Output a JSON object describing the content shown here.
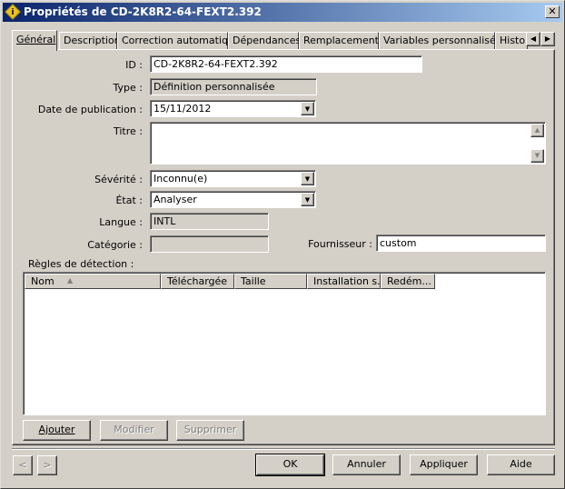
{
  "window": {
    "title": "Propriétés de CD-2K8R2-64-FEXT2.392",
    "close_glyph": "✕"
  },
  "tabs": [
    {
      "label": "Général"
    },
    {
      "label": "Description"
    },
    {
      "label": "Correction automatique"
    },
    {
      "label": "Dépendances"
    },
    {
      "label": "Remplacements"
    },
    {
      "label": "Variables personnalisées"
    },
    {
      "label": "Histori"
    }
  ],
  "tab_scroll": {
    "left": "◀",
    "right": "▶"
  },
  "form": {
    "id_label": "ID :",
    "id_value": "CD-2K8R2-64-FEXT2.392",
    "type_label": "Type :",
    "type_value": "Définition personnalisée",
    "date_label": "Date de publication :",
    "date_value": "15/11/2012",
    "title_label": "Titre :",
    "title_value": "",
    "severity_label": "Sévérité :",
    "severity_value": "Inconnu(e)",
    "state_label": "État :",
    "state_value": "Analyser",
    "language_label": "Langue :",
    "language_value": "INTL",
    "category_label": "Catégorie :",
    "category_value": "",
    "vendor_label": "Fournisseur :",
    "vendor_value": "custom"
  },
  "detection": {
    "label": "Règles de détection :",
    "columns": [
      "Nom",
      "Téléchargée",
      "Taille",
      "Installation s...",
      "Redém..."
    ],
    "rows": []
  },
  "detection_buttons": {
    "add": "Ajouter",
    "modify": "Modifier",
    "delete": "Supprimer"
  },
  "nav": {
    "prev": "<",
    "next": ">"
  },
  "footer": {
    "ok": "OK",
    "cancel": "Annuler",
    "apply": "Appliquer",
    "help": "Aide"
  },
  "colors": {
    "titlebar_start": "#0a246a",
    "titlebar_end": "#a6caf0",
    "face": "#d4d0c8"
  }
}
